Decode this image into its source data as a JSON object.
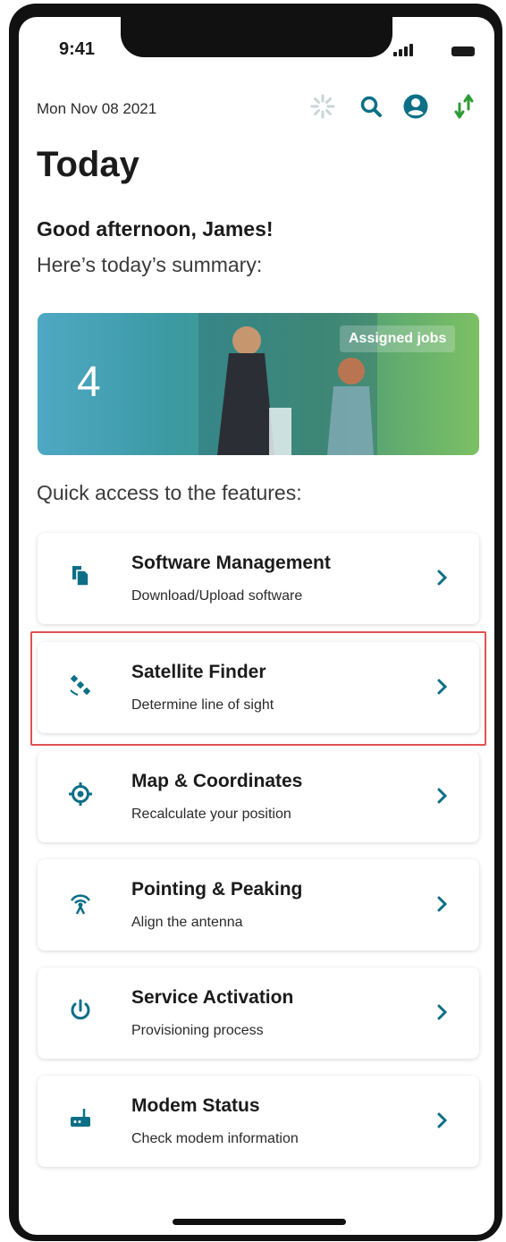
{
  "status_bar": {
    "time": "9:41"
  },
  "header": {
    "date": "Mon Nov 08 2021",
    "icons": [
      "spinner-icon",
      "search-icon",
      "account-icon",
      "sync-icon"
    ]
  },
  "page_title": "Today",
  "greeting": "Good afternoon, James!",
  "summary_label": "Here’s today’s summary:",
  "jobs_card": {
    "count": "4",
    "label": "Assigned jobs"
  },
  "quick_access_label": "Quick access to the features:",
  "features": [
    {
      "title": "Software Management",
      "description": "Download/Upload software",
      "icon": "document-copy-icon"
    },
    {
      "title": "Satellite Finder",
      "description": "Determine line of sight",
      "icon": "satellite-icon"
    },
    {
      "title": "Map & Coordinates",
      "description": "Recalculate your position",
      "icon": "location-target-icon"
    },
    {
      "title": "Pointing & Peaking",
      "description": "Align the antenna",
      "icon": "antenna-signal-icon"
    },
    {
      "title": "Service Activation",
      "description": "Provisioning process",
      "icon": "power-icon"
    },
    {
      "title": "Modem Status",
      "description": "Check modem information",
      "icon": "modem-icon"
    }
  ],
  "colors": {
    "accent": "#0b6f86",
    "sync_up": "#2f9b37",
    "highlight": "#e0524f",
    "text": "#1b1b1b"
  }
}
